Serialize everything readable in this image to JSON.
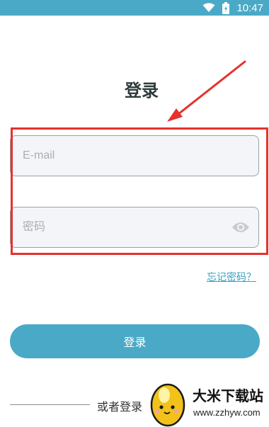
{
  "status_bar": {
    "time": "10:47",
    "icons": [
      "wifi-icon",
      "battery-icon"
    ],
    "color": "#4aa9c6"
  },
  "page": {
    "title": "登录"
  },
  "form": {
    "email_placeholder": "E-mail",
    "password_placeholder": "密码",
    "password_toggle_icon": "eye-icon",
    "forgot_password": "忘记密码？",
    "submit_label": "登录"
  },
  "alt_login": {
    "label": "或者登录"
  },
  "watermark": {
    "name": "大米下载站",
    "url": "www.zzhyw.com"
  },
  "colors": {
    "accent": "#4aa9c6",
    "link": "#3aa0c2",
    "annotation": "#e5322d",
    "field_background": "#f4f5f9"
  }
}
